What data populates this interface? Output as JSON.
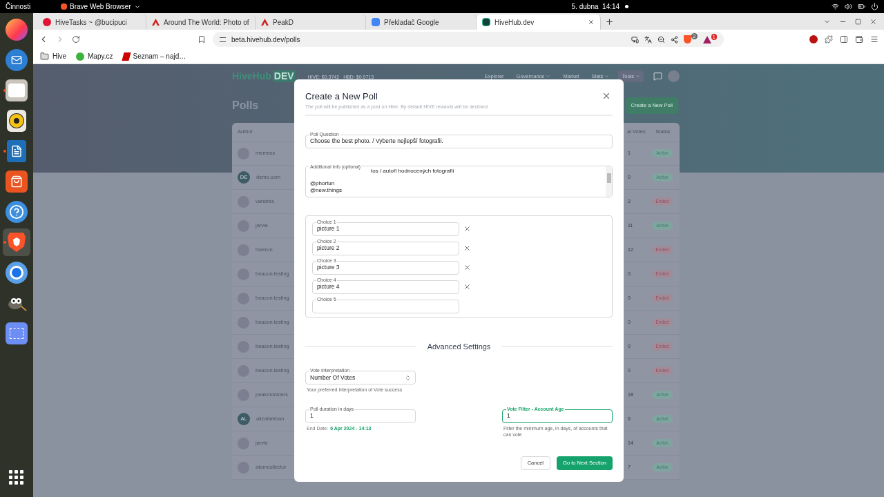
{
  "topbar": {
    "activities": "Činnosti",
    "app": "Brave Web Browser",
    "clock": "5. dubna  14:14"
  },
  "dock": [
    {
      "kind": "firefox",
      "running": false,
      "selected": false
    },
    {
      "kind": "mail",
      "running": false,
      "selected": false
    },
    {
      "kind": "files",
      "running": true,
      "selected": false
    },
    {
      "kind": "speaker",
      "running": false,
      "selected": false
    },
    {
      "kind": "writer",
      "running": true,
      "selected": false
    },
    {
      "kind": "store",
      "running": false,
      "selected": false
    },
    {
      "kind": "help",
      "running": false,
      "selected": false
    },
    {
      "kind": "brave",
      "running": true,
      "selected": true
    },
    {
      "kind": "chromium",
      "running": false,
      "selected": false
    },
    {
      "kind": "gimp",
      "running": false,
      "selected": false
    },
    {
      "kind": "screenshot",
      "running": false,
      "selected": false
    },
    {
      "kind": "apps",
      "running": false,
      "selected": false
    }
  ],
  "browser": {
    "tabs": [
      {
        "title": "HiveTasks ~ @bucipuci",
        "kind": "hive",
        "selected": false
      },
      {
        "title": "Around The World: Photo of",
        "kind": "peak",
        "selected": false
      },
      {
        "title": "PeakD",
        "kind": "peak",
        "selected": false
      },
      {
        "title": "Překladač Google",
        "kind": "translate",
        "selected": false
      },
      {
        "title": "HiveHub.dev",
        "kind": "hivehub",
        "selected": true
      }
    ],
    "url": "beta.hivehub.dev/polls",
    "shield_badge": "2",
    "rewards_badge": "1",
    "bookmarks": [
      {
        "label": "Hive",
        "kind": "folder"
      },
      {
        "label": "Mapy.cz",
        "kind": "mapy"
      },
      {
        "label": "Seznam – najd…",
        "kind": "seznam"
      }
    ]
  },
  "site": {
    "logo": {
      "main": "HiveHub",
      "badge": "DEV"
    },
    "prices": [
      "HIVE: $0.3742",
      "HBD: $0.9713"
    ],
    "nav": [
      {
        "label": "Explorer",
        "dropdown": false,
        "selected": false
      },
      {
        "label": "Governance",
        "dropdown": true,
        "selected": false
      },
      {
        "label": "Market",
        "dropdown": false,
        "selected": false
      },
      {
        "label": "Stats",
        "dropdown": true,
        "selected": false
      },
      {
        "label": "Tools",
        "dropdown": true,
        "selected": true
      }
    ],
    "page_title": "Polls",
    "create_button": "Create a New Poll",
    "table": {
      "columns": [
        "Author",
        "al Votes",
        "Status"
      ],
      "rows": [
        {
          "author": "memess",
          "votes": "1",
          "status": "Active",
          "kind": "active"
        },
        {
          "author": "demo.com",
          "initials": "DE",
          "votes": "0",
          "status": "Active",
          "kind": "active"
        },
        {
          "author": "vandres",
          "votes": "2",
          "status": "Ended",
          "kind": "ended"
        },
        {
          "author": "jarvie",
          "votes": "11",
          "status": "Active",
          "kind": "active"
        },
        {
          "author": "hiverun",
          "votes": "12",
          "status": "Ended",
          "kind": "ended"
        },
        {
          "author": "beacon.testing",
          "votes": "0",
          "status": "Ended",
          "kind": "ended"
        },
        {
          "author": "beacon.testing",
          "votes": "0",
          "status": "Ended",
          "kind": "ended"
        },
        {
          "author": "beacon.testing",
          "votes": "0",
          "status": "Ended",
          "kind": "ended"
        },
        {
          "author": "beacon.testing",
          "votes": "0",
          "status": "Ended",
          "kind": "ended"
        },
        {
          "author": "beacon.testing",
          "votes": "0",
          "status": "Ended",
          "kind": "ended"
        },
        {
          "author": "peakmonsters",
          "votes": "18",
          "status": "Active",
          "kind": "active"
        },
        {
          "author": "alizafarkhan",
          "initials": "AL",
          "votes": "6",
          "status": "Active",
          "kind": "active"
        },
        {
          "author": "jarvie",
          "votes": "14",
          "status": "Active",
          "kind": "active"
        },
        {
          "author": "atomcollector",
          "votes": "7",
          "status": "Active",
          "kind": "active"
        }
      ]
    }
  },
  "modal": {
    "title": "Create a New Poll",
    "subtitle": "The poll will be published as a post on Hive. By default HIVE rewards will be declined.",
    "question": {
      "label": "Poll Question",
      "value": "Choose the best photo. / Vyberte nejlepší fotografii."
    },
    "info": {
      "label": "Additional info",
      "hint": "(optional)",
      "lines": [
        "tos / autoři hodnocených fotografií",
        "@phortun",
        "@new.things"
      ]
    },
    "choices": [
      {
        "label": "Choice 1",
        "value": "picture 1",
        "removable": true
      },
      {
        "label": "Choice 2",
        "value": "picture 2",
        "removable": true
      },
      {
        "label": "Choice 3",
        "value": "picture 3",
        "removable": true
      },
      {
        "label": "Choice 4",
        "value": "picture 4",
        "removable": true
      },
      {
        "label": "Choice 5",
        "removable": false
      }
    ],
    "advanced_title": "Advanced Settings",
    "vote_interpretation": {
      "label": "Vote Interpretation",
      "value": "Number Of Votes",
      "help": "Your preferred interpretation of Vote success"
    },
    "duration": {
      "label": "Poll duration in days",
      "value": "1",
      "end_label": "End Date:",
      "end_value": "6 Apr 2024 - 14:13"
    },
    "filter": {
      "label": "Vote Filter - Account Age",
      "value": "1",
      "help": "Filter the minimum age, in days, of accounts that can vote",
      "focused": true
    },
    "cancel": "Cancel",
    "next": "Go to Next Section"
  }
}
